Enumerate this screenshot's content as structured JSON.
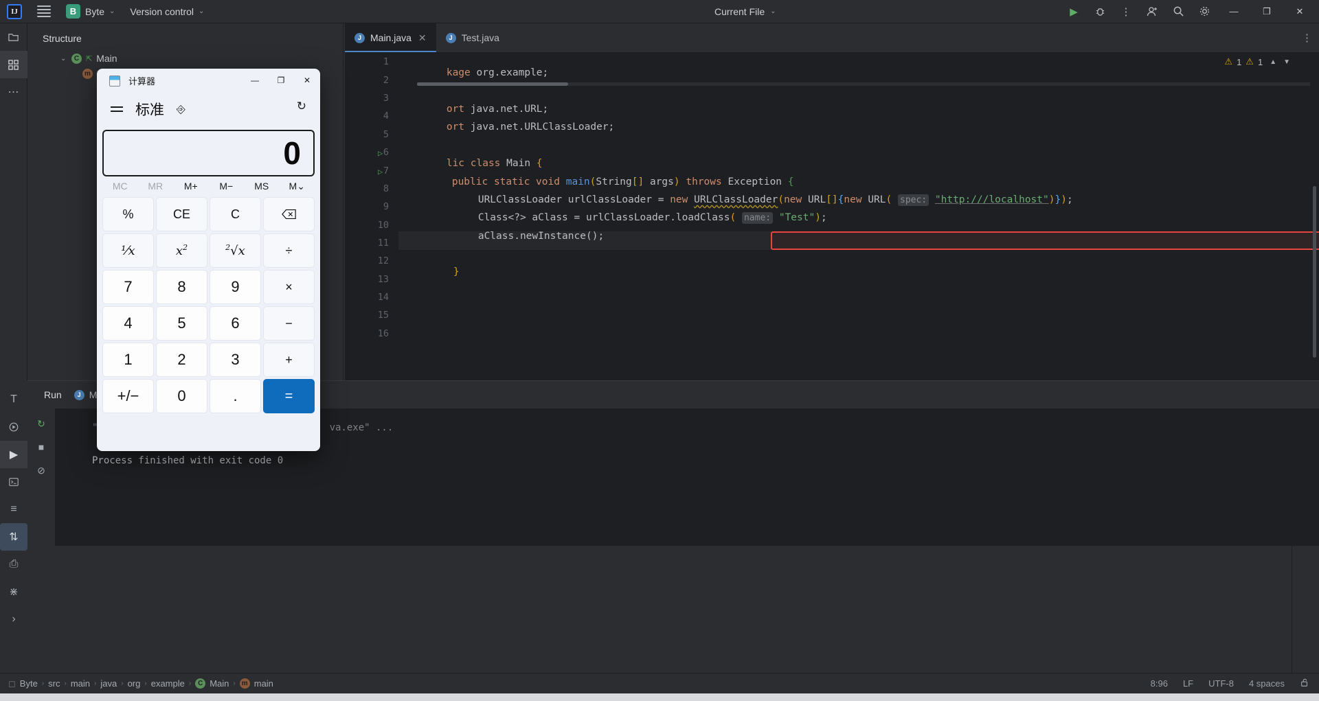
{
  "topbar": {
    "logo": "IJ",
    "menu_icon": "hamburger-icon",
    "project_badge": "B",
    "project_name": "Byte",
    "vcs_label": "Version control",
    "run_config": "Current File",
    "chevron": "⌄",
    "icons": {
      "run": "▶",
      "debug": "debug-icon",
      "more": "⋮",
      "account": "account-icon",
      "search": "search-icon",
      "settings": "gear-icon",
      "minimize": "—",
      "maximize": "❐",
      "close": "✕"
    }
  },
  "rail": {
    "items": [
      {
        "name": "project",
        "glyph": "὜1"
      },
      {
        "name": "structure",
        "glyph": "structure-icon"
      },
      {
        "name": "more-tools",
        "glyph": "⋯"
      },
      {
        "name": "terminal-text",
        "glyph": "T"
      },
      {
        "name": "run-debug",
        "glyph": "▷"
      },
      {
        "name": "run",
        "glyph": "▶"
      },
      {
        "name": "terminal",
        "glyph": "⌨"
      },
      {
        "name": "services",
        "glyph": "≡"
      },
      {
        "name": "sort",
        "glyph": "⇅"
      },
      {
        "name": "print",
        "glyph": "⎙"
      },
      {
        "name": "vcs-branch",
        "glyph": "⎇"
      },
      {
        "name": "expand",
        "glyph": "›"
      }
    ],
    "right_items": [
      {
        "name": "notifications",
        "glyph": "ὑ4"
      },
      {
        "name": "ai-assistant",
        "glyph": "◈"
      },
      {
        "name": "database",
        "glyph": "▤"
      },
      {
        "name": "maven",
        "glyph": "m"
      }
    ]
  },
  "structure": {
    "title": "Structure",
    "nodes": [
      {
        "twisty": "⌄",
        "icon": "class-icon",
        "badge": "C",
        "label": "Main",
        "lock": true
      },
      {
        "twisty": "",
        "icon": "method-icon",
        "badge": "m",
        "label": "m",
        "lock": true
      }
    ]
  },
  "editor": {
    "tabs": [
      {
        "label": "Main.java",
        "active": true,
        "closable": true
      },
      {
        "label": "Test.java",
        "active": false,
        "closable": false
      }
    ],
    "warnings": {
      "count_a": "1",
      "count_b": "1"
    },
    "lines": [
      {
        "num": "1",
        "runmark": false,
        "text": "kage org.example;"
      },
      {
        "num": "2",
        "runmark": false,
        "text": ""
      },
      {
        "num": "3",
        "runmark": false,
        "text": "ort java.net.URL;"
      },
      {
        "num": "4",
        "runmark": false,
        "text": "ort java.net.URLClassLoader;"
      },
      {
        "num": "5",
        "runmark": false,
        "text": ""
      },
      {
        "num": "6",
        "runmark": true,
        "text": "lic class Main {"
      },
      {
        "num": "7",
        "runmark": true,
        "text": "public static void main(String[] args) throws Exception {"
      },
      {
        "num": "8",
        "runmark": false,
        "text": "URLClassLoader urlClassLoader = new URLClassLoader(new URL[]{new URL( spec: \"http:///localhost\")});"
      },
      {
        "num": "9",
        "runmark": false,
        "text": "Class<?> aClass = urlClassLoader.loadClass( name: \"Test\");"
      },
      {
        "num": "10",
        "runmark": false,
        "text": "aClass.newInstance();"
      },
      {
        "num": "11",
        "runmark": false,
        "text": ""
      },
      {
        "num": "12",
        "runmark": false,
        "text": "}"
      },
      {
        "num": "13",
        "runmark": false,
        "text": ""
      },
      {
        "num": "14",
        "runmark": false,
        "text": ""
      },
      {
        "num": "15",
        "runmark": false,
        "text": ""
      },
      {
        "num": "16",
        "runmark": false,
        "text": ""
      }
    ],
    "line8": {
      "type": "URLClassLoader",
      "var": "urlClassLoader",
      "new1": "new",
      "ctor": "URLClassLoader",
      "new2": "new",
      "arr": "URL[]",
      "new3": "new",
      "url": "URL",
      "hint": "spec:",
      "str": "\"http:///localhost\""
    },
    "line9": {
      "cls": "Class<?>",
      "var": "aClass",
      "call": "urlClassLoader.loadClass(",
      "hint": "name:",
      "str": "\"Test\""
    },
    "line10": "aClass.newInstance();"
  },
  "run_panel": {
    "title": "Run",
    "tab_label": "Ma",
    "console": [
      "\"C:\\P                                    va.exe\" ...",
      "Process finished with exit code 0"
    ],
    "toolbar": [
      {
        "name": "rerun",
        "glyph": "↻"
      },
      {
        "name": "stop",
        "glyph": "■"
      },
      {
        "name": "clear",
        "glyph": "⊘"
      },
      {
        "name": "scroll-up",
        "glyph": "↑"
      },
      {
        "name": "scroll-down",
        "glyph": "↓"
      },
      {
        "name": "soft-wrap",
        "glyph": "↵"
      },
      {
        "name": "scroll-to-end",
        "glyph": "↧"
      },
      {
        "name": "print",
        "glyph": "⎙"
      }
    ]
  },
  "status": {
    "breadcrumbs": [
      "Byte",
      "src",
      "main",
      "java",
      "org",
      "example",
      "Main",
      "main"
    ],
    "project_glyph": "□",
    "class_glyph": "C",
    "method_glyph": "m",
    "separator": "›",
    "caret": "8:96",
    "line_sep": "LF",
    "encoding": "UTF-8",
    "indent": "4 spaces",
    "lock": "ὑ3"
  },
  "calculator": {
    "title": "计算器",
    "mode": "标准",
    "menu_icon": "hamburger-icon",
    "keep_on_top_icon": "pin-icon",
    "history_icon": "history-icon",
    "window_buttons": {
      "minimize": "—",
      "maximize": "❐",
      "close": "✕"
    },
    "display_value": "0",
    "memory": [
      {
        "label": "MC",
        "disabled": true
      },
      {
        "label": "MR",
        "disabled": true
      },
      {
        "label": "M+",
        "disabled": false
      },
      {
        "label": "M−",
        "disabled": false
      },
      {
        "label": "MS",
        "disabled": false
      },
      {
        "label": "M⌄",
        "disabled": false
      }
    ],
    "keys": [
      {
        "label": "%",
        "kind": "fn"
      },
      {
        "label": "CE",
        "kind": "fn"
      },
      {
        "label": "C",
        "kind": "fn"
      },
      {
        "label": "⌫",
        "kind": "fn"
      },
      {
        "label": "1/x",
        "kind": "fn"
      },
      {
        "label": "x2",
        "kind": "fn"
      },
      {
        "label": "sqrt",
        "kind": "fn"
      },
      {
        "label": "÷",
        "kind": "fn"
      },
      {
        "label": "7",
        "kind": "num"
      },
      {
        "label": "8",
        "kind": "num"
      },
      {
        "label": "9",
        "kind": "num"
      },
      {
        "label": "×",
        "kind": "fn"
      },
      {
        "label": "4",
        "kind": "num"
      },
      {
        "label": "5",
        "kind": "num"
      },
      {
        "label": "6",
        "kind": "num"
      },
      {
        "label": "−",
        "kind": "fn"
      },
      {
        "label": "1",
        "kind": "num"
      },
      {
        "label": "2",
        "kind": "num"
      },
      {
        "label": "3",
        "kind": "num"
      },
      {
        "label": "+",
        "kind": "fn"
      },
      {
        "label": "+/−",
        "kind": "num"
      },
      {
        "label": "0",
        "kind": "num"
      },
      {
        "label": ".",
        "kind": "num"
      },
      {
        "label": "=",
        "kind": "eq"
      }
    ]
  }
}
